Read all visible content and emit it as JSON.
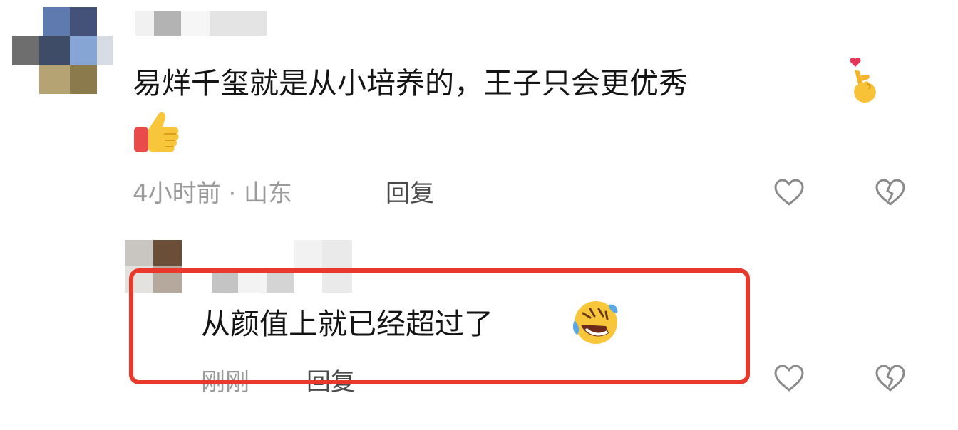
{
  "comments": [
    {
      "text_line1": "易烊千玺就是从小培养的，王子只会更优秀",
      "emoji_after_text": "heart-finger-emoji",
      "emoji_line2": "thumbs-up-emoji",
      "time_location": "4小时前 · 山东",
      "reply_label": "回复",
      "like_icon": "heart-outline-icon",
      "dislike_icon": "broken-heart-icon"
    },
    {
      "text_line1": "从颜值上就已经超过了",
      "emoji_after_text": "rolling-laughing-emoji",
      "time_location": "刚刚",
      "reply_label": "回复",
      "like_icon": "heart-outline-icon",
      "dislike_icon": "broken-heart-icon",
      "highlighted": true
    }
  ],
  "colors": {
    "highlight_border": "#e8392c",
    "text": "#141414",
    "meta": "#9a9a9a",
    "reply": "#4a4a4a",
    "icon": "#8a8a8a"
  }
}
